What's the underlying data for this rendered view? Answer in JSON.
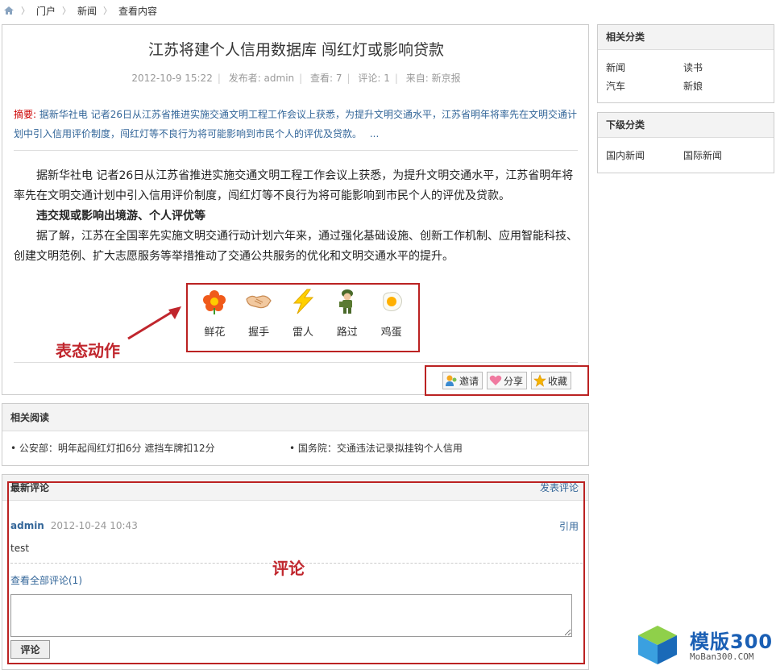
{
  "breadcrumb": {
    "items": [
      "门户",
      "新闻",
      "查看内容"
    ]
  },
  "article": {
    "title": "江苏将建个人信用数据库 闯红灯或影响贷款",
    "date": "2012-10-9 15:22",
    "author": "发布者: admin",
    "views": "查看: 7",
    "comments": "评论: 1",
    "source": "来自: 新京报",
    "summary_label": "摘要:",
    "summary": "据新华社电 记者26日从江苏省推进实施交通文明工程工作会议上获悉，为提升文明交通水平，江苏省明年将率先在文明交通计划中引入信用评价制度，闯红灯等不良行为将可能影响到市民个人的评优及贷款。",
    "summary_more": "...",
    "paragraphs": [
      "据新华社电 记者26日从江苏省推进实施交通文明工程工作会议上获悉，为提升文明交通水平，江苏省明年将率先在文明交通计划中引入信用评价制度，闯红灯等不良行为将可能影响到市民个人的评优及贷款。",
      "违交规或影响出境游、个人评优等",
      "据了解，江苏在全国率先实施文明交通行动计划六年来，通过强化基础设施、创新工作机制、应用智能科技、创建文明范例、扩大志愿服务等举措推动了交通公共服务的优化和文明交通水平的提升。"
    ],
    "reactions": [
      {
        "label": "鲜花",
        "icon": "flower-icon"
      },
      {
        "label": "握手",
        "icon": "handshake-icon"
      },
      {
        "label": "雷人",
        "icon": "lightning-icon"
      },
      {
        "label": "路过",
        "icon": "soldier-icon"
      },
      {
        "label": "鸡蛋",
        "icon": "egg-icon"
      }
    ],
    "reaction_annotation": "表态动作",
    "tools": [
      {
        "label": "邀请",
        "icon": "invite-icon"
      },
      {
        "label": "分享",
        "icon": "heart-icon"
      },
      {
        "label": "收藏",
        "icon": "star-icon"
      }
    ]
  },
  "related": {
    "title": "相关阅读",
    "items": [
      "• 公安部：明年起闯红灯扣6分 遮挡车牌扣12分",
      "• 国务院：交通违法记录拟挂钩个人信用"
    ]
  },
  "comments": {
    "title": "最新评论",
    "post_link": "发表评论",
    "list": [
      {
        "author": "admin",
        "time": "2012-10-24 10:43",
        "quote": "引用",
        "text": "test"
      }
    ],
    "view_all": "查看全部评论(1)",
    "annotation": "评论",
    "submit_label": "评论"
  },
  "sidebar": {
    "related_categories": {
      "title": "相关分类",
      "items": [
        "新闻",
        "读书",
        "汽车",
        "新娘"
      ]
    },
    "sub_categories": {
      "title": "下级分类",
      "items": [
        "国内新闻",
        "国际新闻"
      ]
    }
  },
  "watermark": {
    "cn": "模版300",
    "en": "MoBan300.COM"
  },
  "colors": {
    "accent": "#336699",
    "annotation": "#c0262d",
    "frame": "#b22222"
  }
}
